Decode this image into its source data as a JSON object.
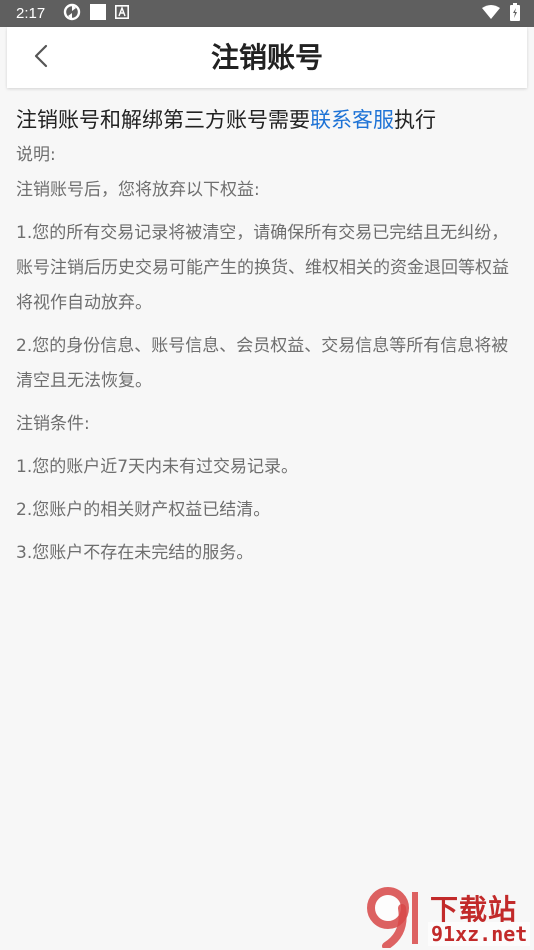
{
  "status_bar": {
    "time": "2:17",
    "icons": [
      "sync-icon",
      "square-icon",
      "a-notification-icon",
      "wifi-icon",
      "battery-icon"
    ],
    "background": "#5f5f5f"
  },
  "header": {
    "back_icon": "chevron-left-icon",
    "title": "注销账号"
  },
  "content": {
    "intro_prefix": "注销账号和解绑第三方账号需要",
    "intro_link": "联系客服",
    "intro_suffix": "执行",
    "link_color": "#1e73d6",
    "explain_label": "说明:",
    "give_up_label": "注销账号后，您将放弃以下权益:",
    "rights": [
      "1.您的所有交易记录将被清空，请确保所有交易已完结且无纠纷，账号注销后历史交易可能产生的换货、维权相关的资金退回等权益将视作自动放弃。",
      "2.您的身份信息、账号信息、会员权益、交易信息等所有信息将被清空且无法恢复。"
    ],
    "conditions_label": "注销条件:",
    "conditions": [
      "1.您的账户近7天内未有过交易记录。",
      "2.您账户的相关财产权益已结清。",
      "3.您账户不存在未完结的服务。"
    ]
  },
  "watermark": {
    "text_top": "下载站",
    "text_bottom": "91xz.net",
    "color": "#c22a2a"
  }
}
